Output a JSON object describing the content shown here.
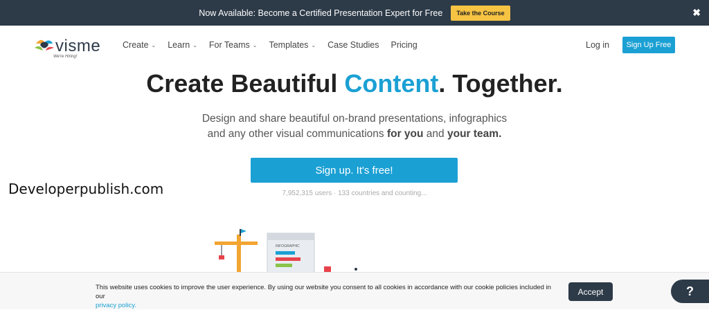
{
  "topbar": {
    "message": "Now Available: Become a Certified Presentation Expert for Free",
    "cta_label": "Take the Course",
    "close_label": "✖"
  },
  "nav": {
    "logo_text": "visme",
    "logo_tagline": "We're Hiring!",
    "items": [
      {
        "label": "Create",
        "dropdown": true
      },
      {
        "label": "Learn",
        "dropdown": true
      },
      {
        "label": "For Teams",
        "dropdown": true
      },
      {
        "label": "Templates",
        "dropdown": true
      },
      {
        "label": "Case Studies",
        "dropdown": false
      },
      {
        "label": "Pricing",
        "dropdown": false
      }
    ],
    "chevron": "⌄",
    "login_label": "Log in",
    "signup_label": "Sign Up Free"
  },
  "hero": {
    "title_pre": "Create Beautiful ",
    "title_accent": "Content",
    "title_post": ". Together.",
    "sub_line1": "Design and share beautiful on-brand presentations, infographics",
    "sub_line2_pre": "and any other visual communications ",
    "sub_line2_b1": "for you",
    "sub_line2_mid": " and ",
    "sub_line2_b2": "your team.",
    "cta_label": "Sign up. It's free!",
    "stats": "7,952,315 users · 133 countries and counting..."
  },
  "watermark": "Developerpublish.com",
  "illustration_label": "INFOGRAPHIC",
  "cookie": {
    "text": "This website uses cookies to improve the user experience. By using our website you consent to all cookies in accordance with our cookie policies included in our",
    "link_label": "privacy policy.",
    "accept_label": "Accept"
  },
  "help_label": "?",
  "colors": {
    "accent": "#1ba0d4",
    "dark": "#2d3a48",
    "cta_yellow": "#f6c343"
  }
}
